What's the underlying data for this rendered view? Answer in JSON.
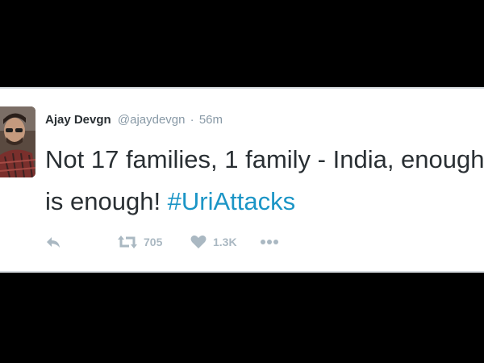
{
  "tweet": {
    "author_name": "Ajay Devgn",
    "author_handle": "@ajaydevgn",
    "separator": "·",
    "timestamp": "56m",
    "text_main": "Not 17 families, 1 family - India, enough is enough! ",
    "hashtag": "#UriAttacks"
  },
  "actions": {
    "reply": {
      "icon": "reply-icon"
    },
    "retweet": {
      "icon": "retweet-icon",
      "count": "705"
    },
    "like": {
      "icon": "heart-icon",
      "count": "1.3K"
    },
    "more": {
      "icon": "more-dots-icon"
    }
  },
  "colors": {
    "background": "#000000",
    "card": "#ffffff",
    "text": "#292f33",
    "muted": "#8899a6",
    "hashtag": "#1b95c6",
    "action_icon": "#aab8c2"
  }
}
